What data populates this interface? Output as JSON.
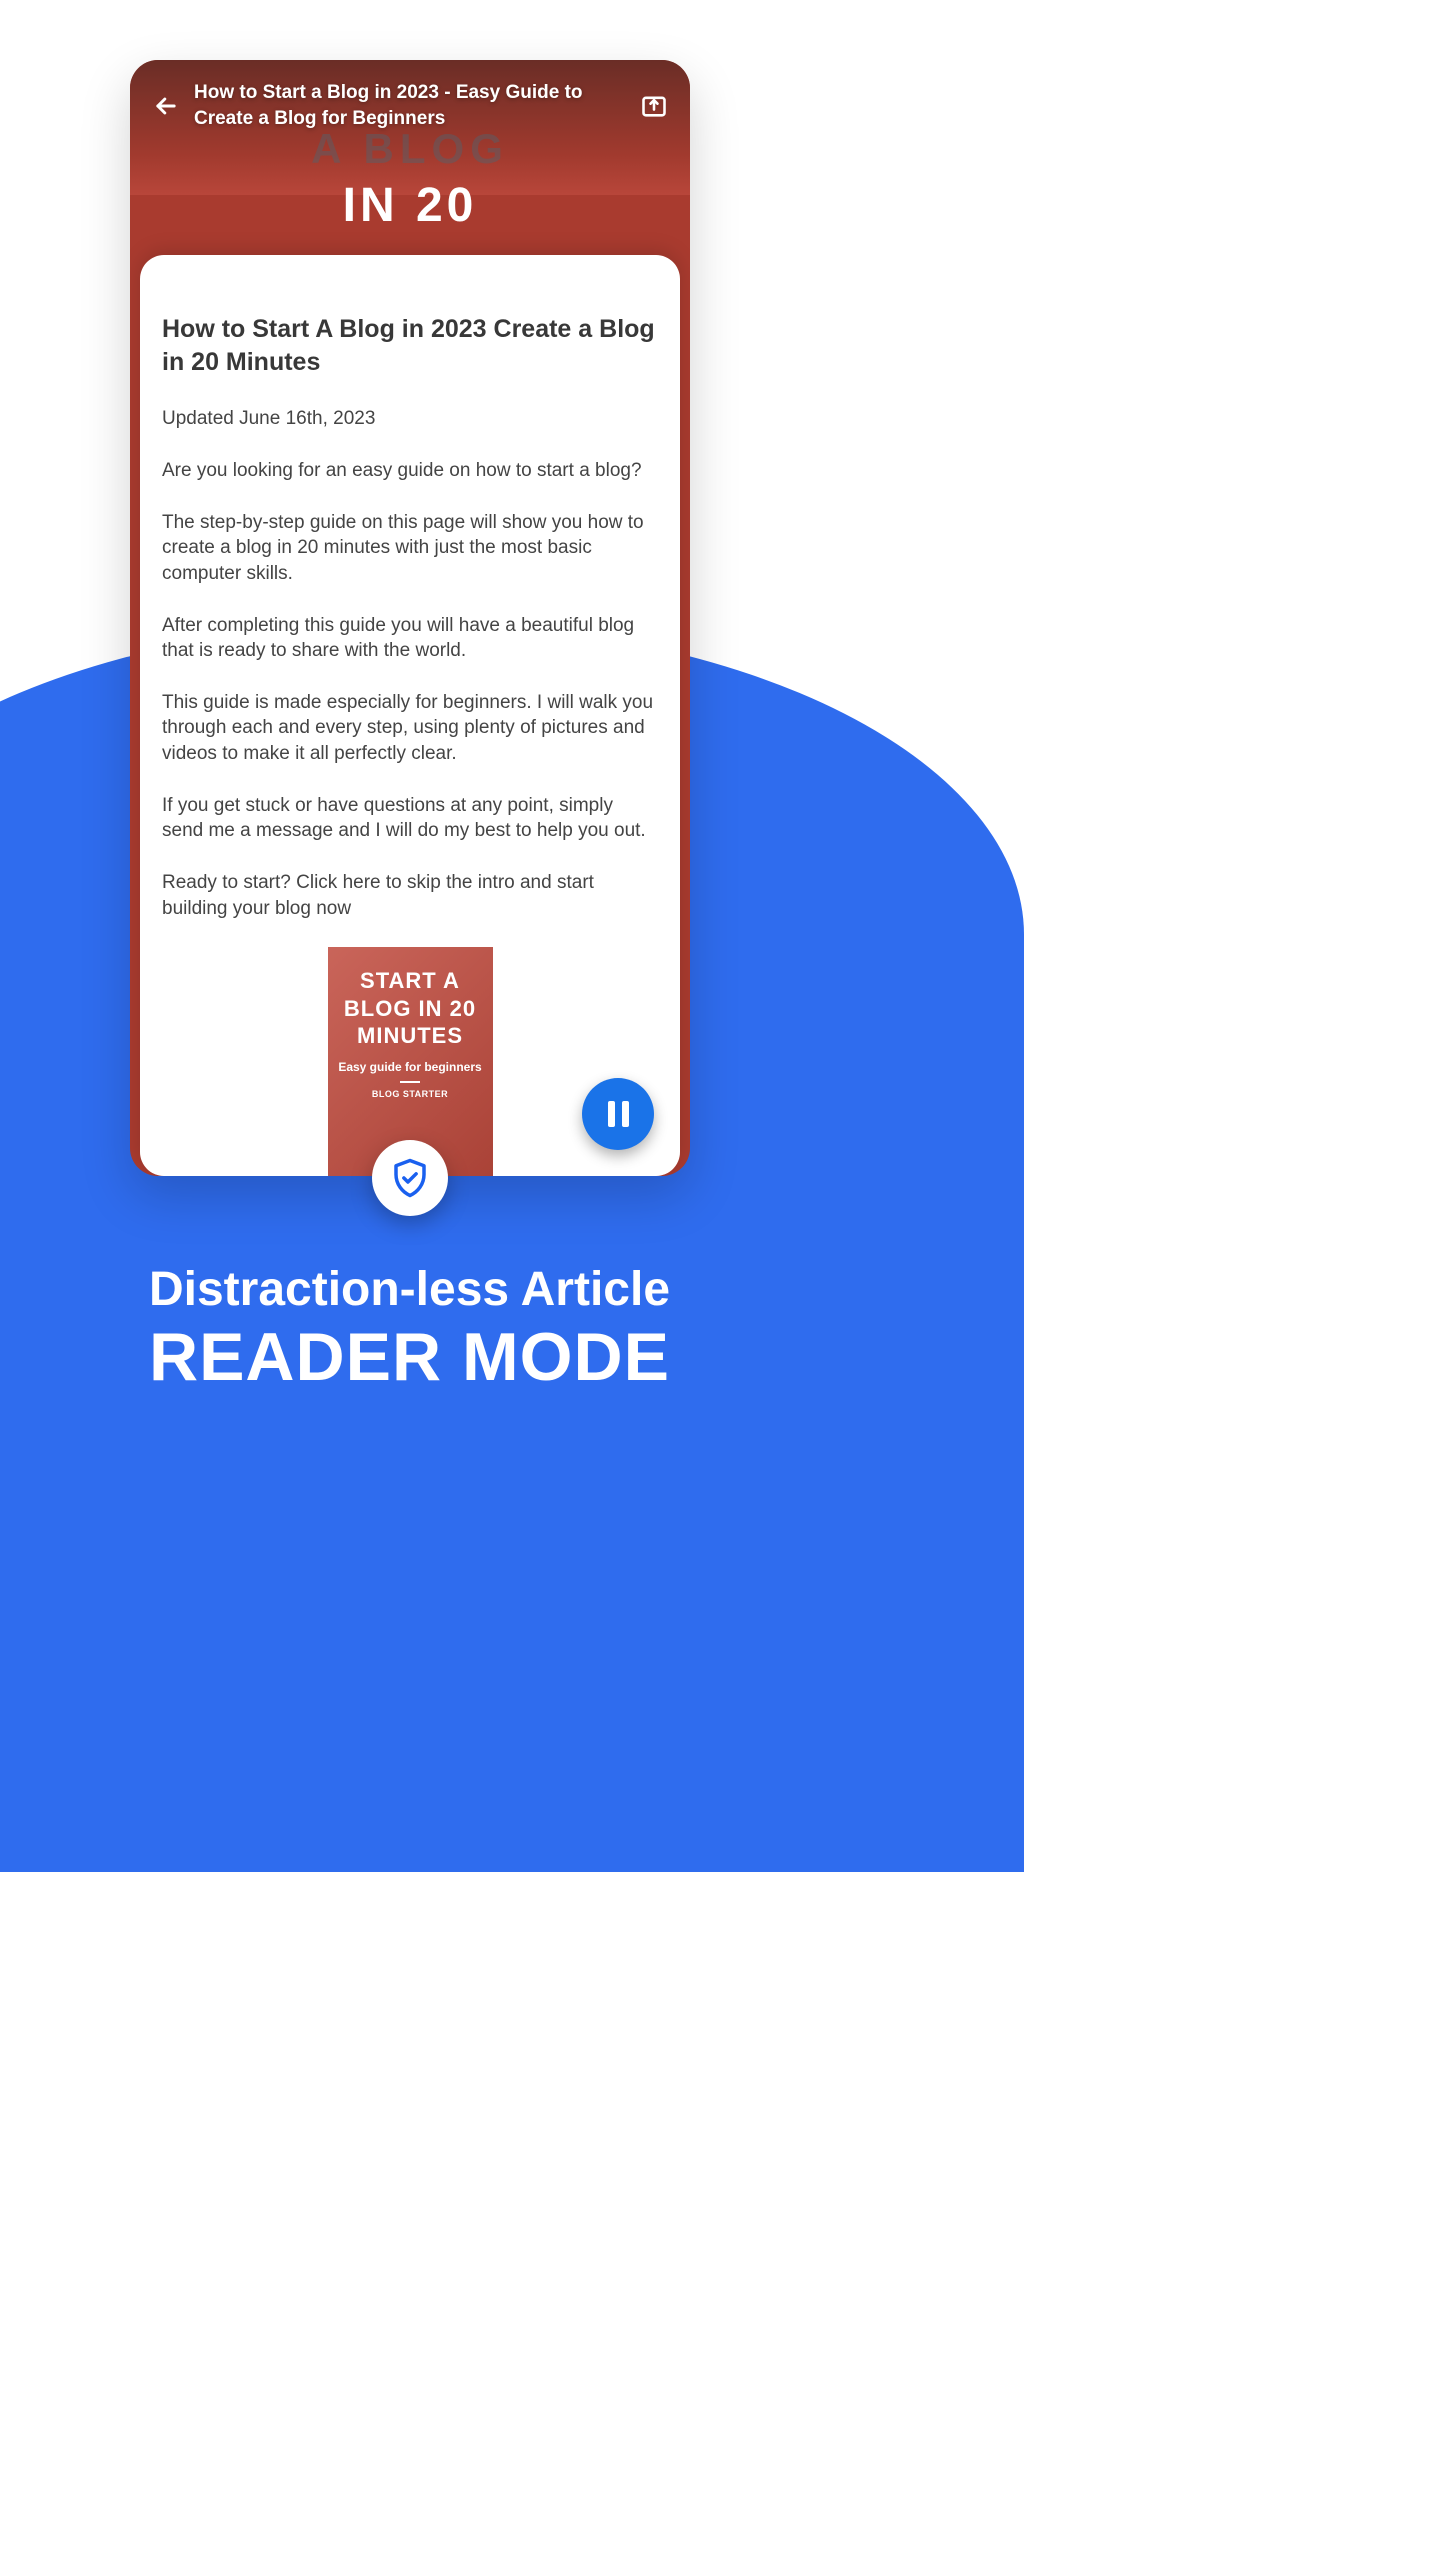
{
  "appBar": {
    "title": "How to Start a Blog in 2023 - Easy Guide to Create a Blog for Beginners"
  },
  "bgText": {
    "line1": "A BLOG",
    "line2": "IN 20"
  },
  "reader": {
    "title": "How to Start A Blog in 2023 Create a Blog in 20 Minutes",
    "meta": "Updated June 16th, 2023",
    "paragraphs": [
      "Are you looking for an easy guide on how to start a blog?",
      "The step-by-step guide on this page will show you how to create a blog in 20 minutes with just the most basic computer skills.",
      "After completing this guide you will have a beautiful blog that is ready to share with the world.",
      "This guide is made especially for beginners. I will walk you through each and every step, using plenty of pictures and videos to make it all perfectly clear.",
      "If you get stuck or have questions at any point, simply send me a message and I will do my best to help you out.",
      "Ready to start? Click here to skip the intro and start building your blog now"
    ]
  },
  "thumb": {
    "big": "START A BLOG IN 20 MINUTES",
    "sub": "Easy guide for beginners",
    "brand": "BLOG STARTER"
  },
  "feature": {
    "title": "Distraction-less Article",
    "subtitle": "READER MODE"
  }
}
